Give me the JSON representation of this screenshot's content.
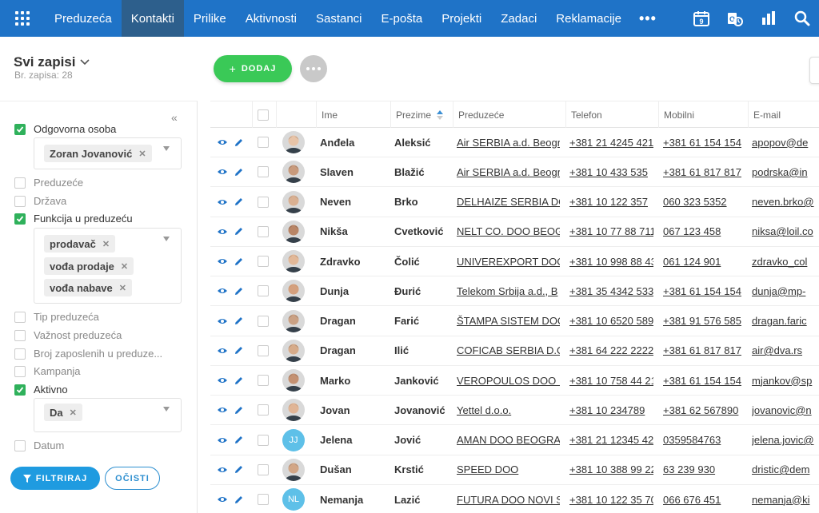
{
  "nav": {
    "items": [
      "Preduzeća",
      "Kontakti",
      "Prilike",
      "Aktivnosti",
      "Sastanci",
      "E-pošta",
      "Projekti",
      "Zadaci",
      "Reklamacije"
    ],
    "active_index": 1,
    "more": "•••",
    "calendar_day": "9"
  },
  "header": {
    "title": "Svi zapisi",
    "subtitle": "Br. zapisa: 28",
    "add_label": "DODAJ"
  },
  "sidebar": {
    "collapse": "«",
    "filter_label": "FILTRIRAJ",
    "clear_label": "OČISTI",
    "filters": [
      {
        "label": "Odgovorna osoba",
        "checked": true
      },
      {
        "label": "Preduzeće",
        "checked": false
      },
      {
        "label": "Država",
        "checked": false
      },
      {
        "label": "Funkcija u preduzeću",
        "checked": true
      },
      {
        "label": "Tip preduzeća",
        "checked": false
      },
      {
        "label": "Važnost preduzeća",
        "checked": false
      },
      {
        "label": "Broj zaposlenih u preduze...",
        "checked": false
      },
      {
        "label": "Kampanja",
        "checked": false
      },
      {
        "label": "Aktivno",
        "checked": true
      },
      {
        "label": "Datum",
        "checked": false
      }
    ],
    "tags_owner": [
      "Zoran Jovanović"
    ],
    "tags_function": [
      "prodavač",
      "vođa prodaje",
      "vođa nabave"
    ],
    "tags_active": [
      "Da"
    ]
  },
  "table": {
    "headers": {
      "ime": "Ime",
      "prezime": "Prezime",
      "preduzece": "Preduzeće",
      "telefon": "Telefon",
      "mobilni": "Mobilni",
      "email": "E-mail"
    },
    "rows": [
      {
        "ime": "Anđela",
        "prezime": "Aleksić",
        "preduzece": "Air SERBIA a.d. Beogr",
        "telefon": "+381 21 4245 421",
        "mobilni": "+381 61 154 154",
        "email": "apopov@de"
      },
      {
        "ime": "Slaven",
        "prezime": "Blažić",
        "preduzece": "Air SERBIA a.d. Beogr",
        "telefon": "+381 10 433 535",
        "mobilni": "+381 61 817 817",
        "email": "podrska@in"
      },
      {
        "ime": "Neven",
        "prezime": "Brko",
        "preduzece": "DELHAIZE SERBIA DO",
        "telefon": "+381 10 122 357",
        "mobilni": "060 323 5352",
        "email": "neven.brko@"
      },
      {
        "ime": "Nikša",
        "prezime": "Cvetković",
        "preduzece": "NELT CO. DOO BEOG",
        "telefon": "+381 10 77 88 711",
        "mobilni": "067 123 458",
        "email": "niksa@loil.co"
      },
      {
        "ime": "Zdravko",
        "prezime": "Čolić",
        "preduzece": "UNIVEREXPORT DOO",
        "telefon": "+381 10 998 88 43",
        "mobilni": "061 124 901",
        "email": "zdravko_col"
      },
      {
        "ime": "Dunja",
        "prezime": "Đurić",
        "preduzece": "Telekom Srbija a.d., B",
        "telefon": "+381 35 4342 533",
        "mobilni": "+381 61 154 154",
        "email": "dunja@mp-"
      },
      {
        "ime": "Dragan",
        "prezime": "Farić",
        "preduzece": "ŠTAMPA SISTEM DOO",
        "telefon": "+381 10 6520 589",
        "mobilni": "+381 91 576 585",
        "email": "dragan.faric"
      },
      {
        "ime": "Dragan",
        "prezime": "Ilić",
        "preduzece": "COFICAB SERBIA D.O",
        "telefon": "+381 64 222 2222",
        "mobilni": "+381 61 817 817",
        "email": "air@dva.rs"
      },
      {
        "ime": "Marko",
        "prezime": "Janković",
        "preduzece": "VEROPOULOS DOO I",
        "telefon": "+381 10 758 44 21",
        "mobilni": "+381 61 154 154",
        "email": "mjankov@sp"
      },
      {
        "ime": "Jovan",
        "prezime": "Jovanović",
        "preduzece": "Yettel d.o.o.",
        "telefon": "+381 10 234789",
        "mobilni": "+381 62 567890",
        "email": "jovanovic@n"
      },
      {
        "ime": "Jelena",
        "prezime": "Jović",
        "preduzece": "AMAN DOO BEOGRA",
        "telefon": "+381 21 12345 421",
        "mobilni": "0359584763",
        "email": "jelena.jovic@",
        "initials": "JJ"
      },
      {
        "ime": "Dušan",
        "prezime": "Krstić",
        "preduzece": "SPEED DOO",
        "telefon": "+381 10 388 99 22",
        "mobilni": "63 239 930",
        "email": "dristic@dem"
      },
      {
        "ime": "Nemanja",
        "prezime": "Lazić",
        "preduzece": "FUTURA DOO NOVI S",
        "telefon": "+381 10 122 35 70",
        "mobilni": "066 676 451",
        "email": "nemanja@ki",
        "initials": "NL"
      }
    ]
  },
  "colors": {
    "topbar": "#1f73c7",
    "active_tab": "#2d5f8c",
    "add": "#3ac957",
    "checkbox_on": "#2fb15b",
    "filter_btn": "#1f9be0",
    "action_icon": "#1f73c7"
  }
}
